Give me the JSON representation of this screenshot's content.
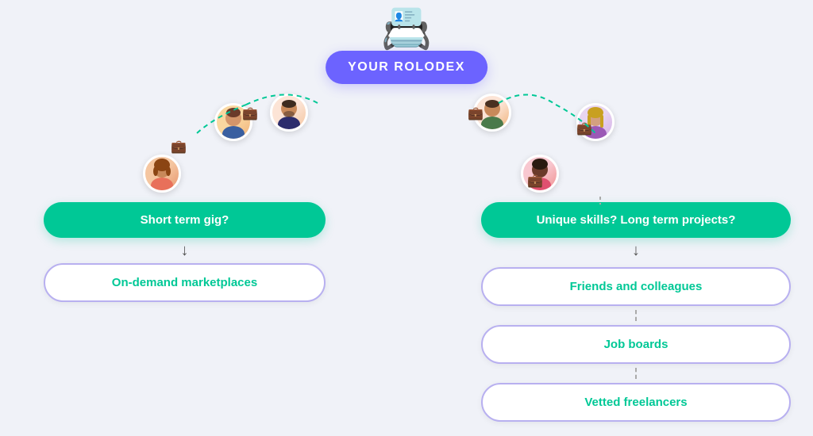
{
  "rolodex": {
    "label": "YOUR ROLODEX",
    "icon": "📇"
  },
  "left": {
    "question": "Short term gig?",
    "answer": "On-demand marketplaces"
  },
  "right": {
    "question": "Unique skills? Long term projects?",
    "options": [
      "Friends and colleagues",
      "Job boards",
      "Vetted freelancers"
    ]
  },
  "avatars": {
    "left1_emoji": "👩",
    "left2_emoji": "👨",
    "left3_emoji": "🧔",
    "right1_emoji": "👨‍🦱",
    "right2_emoji": "👩‍🦰",
    "right3_emoji": "👩🏿"
  },
  "colors": {
    "purple": "#6c63ff",
    "green": "#00c896",
    "bg": "#f0f2f8",
    "outline_border": "#b8b0f0"
  }
}
